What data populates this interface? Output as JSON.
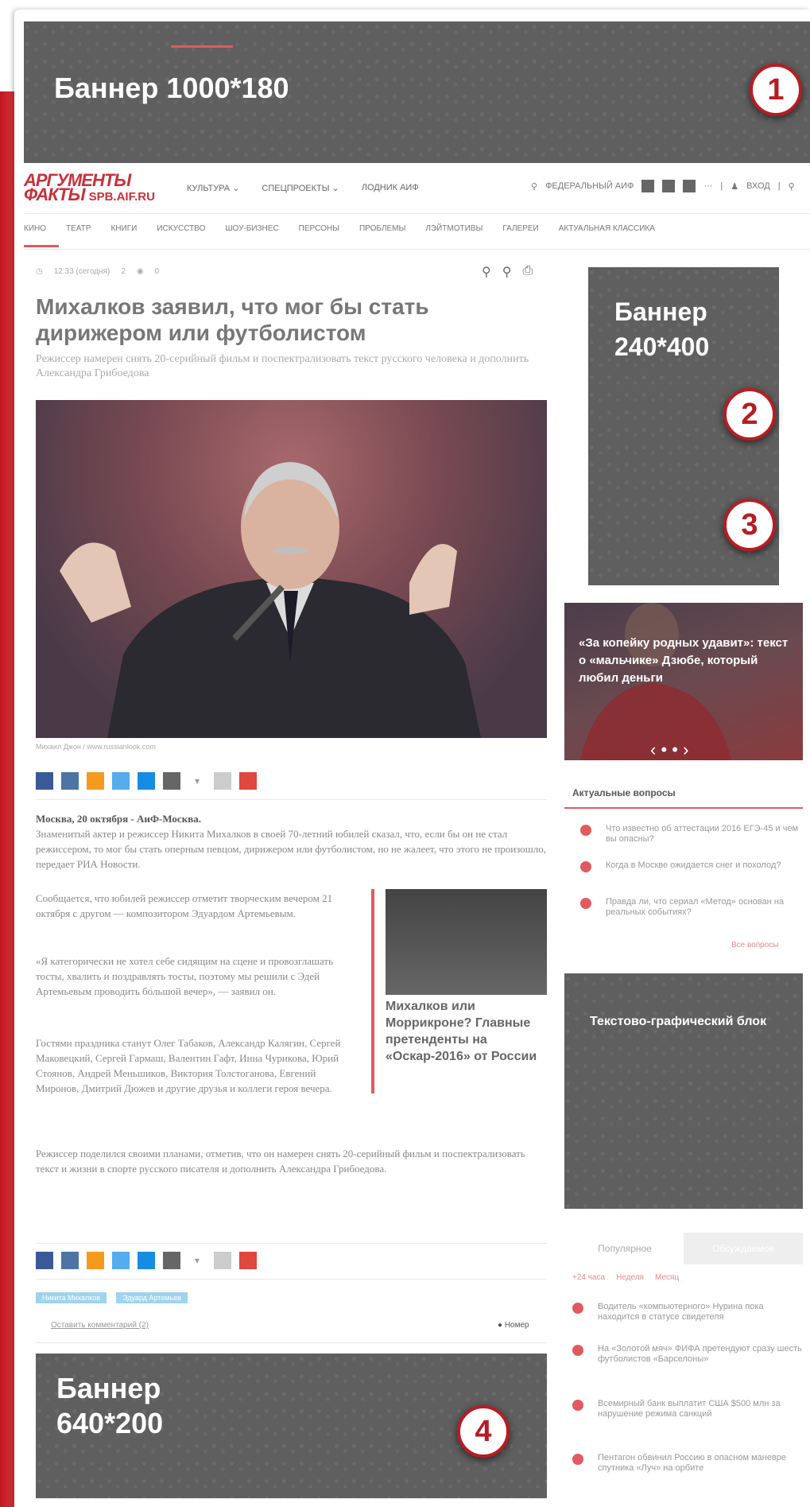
{
  "banners": {
    "top": {
      "label": "Баннер 1000*180",
      "badge": "1"
    },
    "side": {
      "label": "Баннер 240*400",
      "badge2": "2",
      "badge3": "3"
    },
    "text_graphic": {
      "label": "Текстово-графический блок"
    },
    "bottom": {
      "label": "Баннер 640*200",
      "badge": "4"
    }
  },
  "header": {
    "logo_line1": "АРГУМЕНТЫ",
    "logo_line2": "ФАКТЫ",
    "logo_domain": "SPB.AIF.RU",
    "nav": [
      "КУЛЬТУРА ⌄",
      "СПЕЦПРОЕКТЫ ⌄",
      "ЛОДНИК АИФ"
    ],
    "region": "ФЕДЕРАЛЬНЫЙ АИФ",
    "login": "ВХОД",
    "more": "···"
  },
  "subnav": [
    "КИНО",
    "ТЕАТР",
    "КНИГИ",
    "ИСКУССТВО",
    "ШОУ-БИЗНЕС",
    "ПЕРСОНЫ",
    "ПРОБЛЕМЫ",
    "ЛЭЙТМОТИВЫ",
    "ГАЛЕРЕИ",
    "АКТУАЛЬНАЯ КЛАССИКА"
  ],
  "article": {
    "time": "12:33 (сегодня)",
    "views": "0",
    "comments_count": "2",
    "title": "Михалков заявил, что мог бы стать дирижером или футболистом",
    "lead": "Режиссер намерен снять 20-серийный фильм и поспектрализовать текст русского человека и дополнить Александра Грибоедова",
    "photo_credit": "Михаил Джон / www.russianlook.com",
    "dateline": "Москва, 20 октября - АиФ-Москва.",
    "p1": "Знаменитый актер и режиссер Никита Михалков в своей 70-летний юбилей сказал, что, если бы он не стал режиссером, то мог бы стать оперным певцом, дирижером или футболистом, но не жалеет, что этого не произошло, передает РИА Новости.",
    "p2": "Сообщается, что юбилей режиссер отметит творческим вечером 21 октября с другом — композитором Эдуардом Артемьевым.",
    "p3": "«Я категорически не хотел себе сидящим на сцене и провозглашать тосты, хвалить и поздравлять тосты, поэтому мы решили с Эдей Артемьевым проводить большой вечер», — заявил он.",
    "p4": "Гостями праздника станут Олег Табаков, Александр Калягин, Сергей Маковецкий, Сергей Гармаш, Валентин Гафт, Инна Чурикова, Юрий Стоянов, Андрей Меньшиков, Виктория Толстоганова, Евгений Миронов, Дмитрий Дюжев и другие друзья и коллеги героя вечера.",
    "p5": "Режиссер поделился своими планами, отметив, что он намерен снять 20-серийный фильм и поспектрализовать текст и жизни в спорте русского писателя и дополнить Александра Грибоедова.",
    "related_title": "Михалков или Моррикроне? Главные претенденты на «Оскар-2016» от России",
    "tags": [
      "Никита Михалков",
      "Эдуард Артемьев"
    ],
    "comments_link": "Оставить комментарий (2)",
    "comments_right": "Номер"
  },
  "sidebar": {
    "slider_title": "«За копейку родных удавит»: текст о «мальчике» Дзюбе, который любил деньги",
    "slider_nav": "‹  • • ›",
    "actual_title": "Актуальные вопросы",
    "questions": [
      "Что известно об аттестации 2016 ЕГЭ-45 и чем вы опасны?",
      "Когда в Москве ожидается снег и похолод?",
      "Правда ли, что сериал «Метод» основан на реальных событиях?"
    ],
    "all_questions": "Все вопросы",
    "tab_popular": "Популярное",
    "tab_other": "Обсуждаемое",
    "filters": [
      "+24 часа",
      "Неделя",
      "Месяц"
    ],
    "popular": [
      "Водитель «компьютерного» Нурина пока находится в статусе свидетеля",
      "На «Золотой мяч» ФИФА претендуют сразу шесть футболистов «Барселоны»",
      "Всемирный банк выплатит США $500 млн за нарушение режима санкций",
      "Пентагон обвинил Россию в опасном маневре спутника «Луч» на орбите"
    ]
  },
  "colors": {
    "accent": "#e15a60",
    "banner": "#5f5f5f",
    "brand_red": "#c0171d"
  }
}
